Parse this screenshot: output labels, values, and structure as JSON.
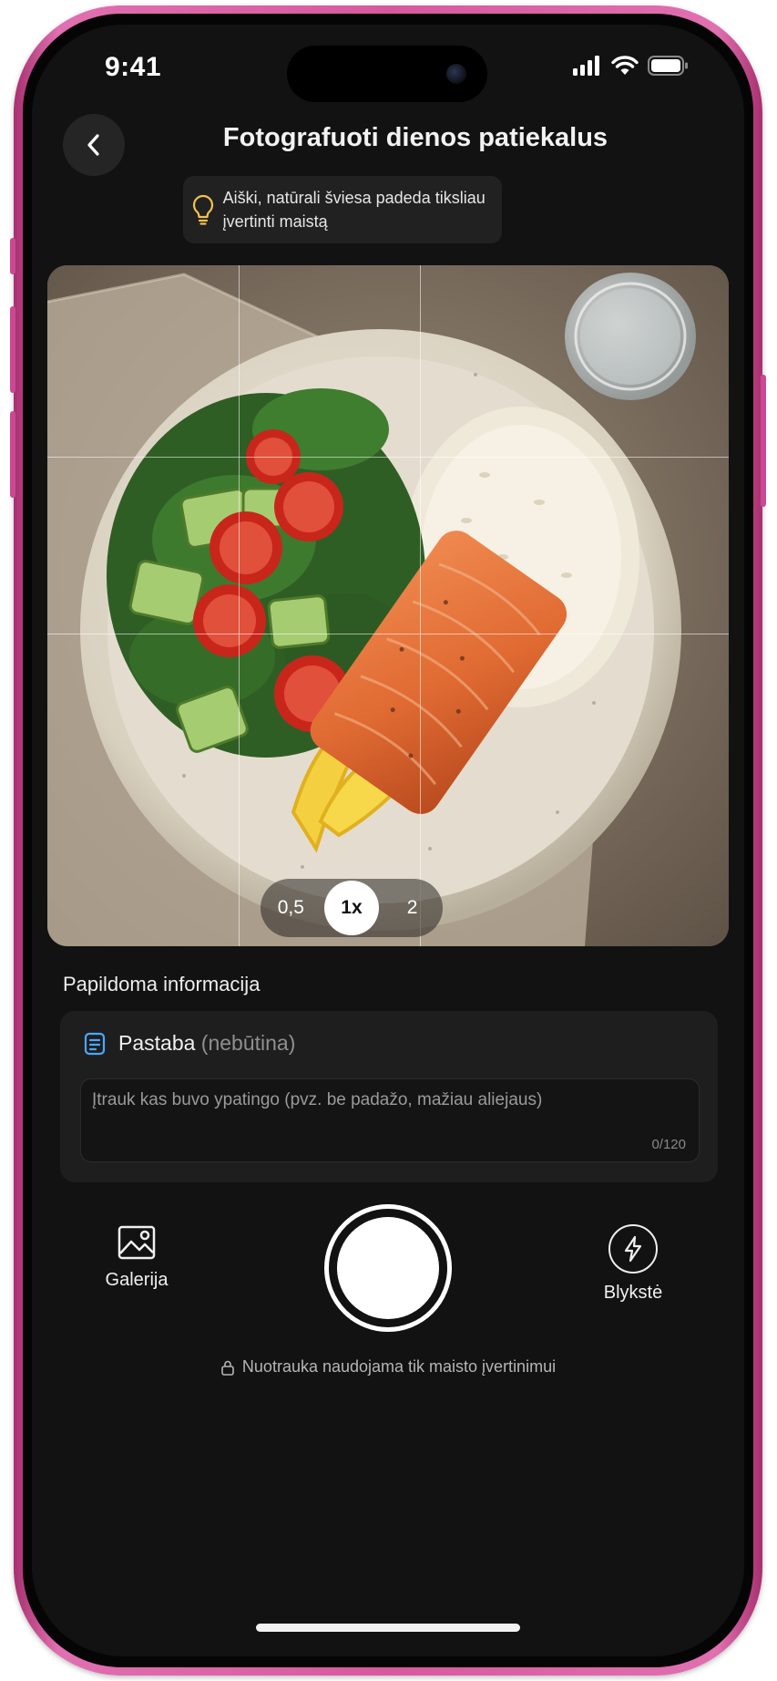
{
  "status_bar": {
    "time": "9:41"
  },
  "header": {
    "title": "Fotografuoti dienos patiekalus"
  },
  "tip": {
    "text": "Aiški, natūrali šviesa padeda tiksliau įvertinti maistą"
  },
  "camera": {
    "zoom_options": [
      "0,5",
      "1x",
      "2"
    ],
    "selected_zoom": "1x"
  },
  "additional_info": {
    "section_label": "Papildoma informacija",
    "note_label": "Pastaba",
    "note_optional": "(nebūtina)",
    "note_placeholder": "Įtrauk kas buvo ypatingo (pvz. be padažo, mažiau aliejaus)",
    "note_counter": "0/120"
  },
  "controls": {
    "gallery_label": "Galerija",
    "flash_label": "Blykstė"
  },
  "footer": {
    "privacy_text": "Nuotrauka naudojama tik maisto įvertinimui"
  },
  "colors": {
    "frame": "#d8589e",
    "screen_bg": "#121212",
    "tip_icon": "#f2c14e",
    "note_icon": "#4aa8ff"
  }
}
